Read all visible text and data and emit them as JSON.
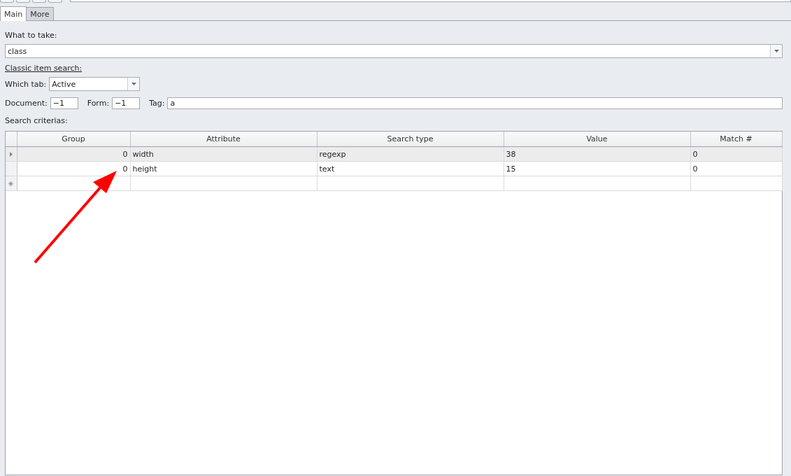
{
  "tabs": [
    {
      "label": "Main",
      "selected": true
    },
    {
      "label": "More",
      "selected": false
    }
  ],
  "what_to_take": {
    "label": "What to take:",
    "value": "class"
  },
  "classic_search": {
    "label": "Classic item search:"
  },
  "which_tab": {
    "label": "Which tab:",
    "value": "Active"
  },
  "fields": [
    {
      "label": "Document:",
      "value": "−1"
    },
    {
      "label": "Form:",
      "value": "−1"
    },
    {
      "label": "Tag:",
      "value": "a"
    }
  ],
  "search_criterias": {
    "label": "Search criterias:",
    "table": {
      "columns": [
        "Group",
        "Attribute",
        "Search type",
        "Value",
        "Match #"
      ],
      "rows": [
        {
          "cells": [
            "0",
            "width",
            "regexp",
            "38",
            "0"
          ],
          "selected": true
        },
        {
          "cells": [
            "0",
            "height",
            "text",
            "15",
            "0"
          ],
          "selected": false
        }
      ]
    }
  },
  "annotation": {
    "kind": "arrow",
    "color": "#ff0000"
  }
}
